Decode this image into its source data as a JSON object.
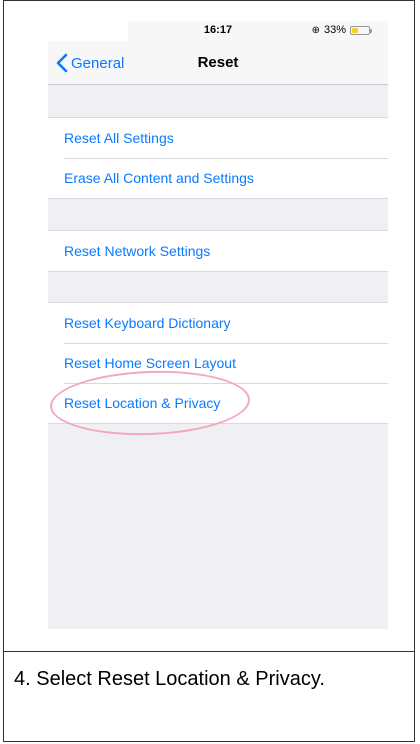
{
  "statusbar": {
    "time": "16:17",
    "battery_percent": "33%"
  },
  "navbar": {
    "back_label": "General",
    "title": "Reset"
  },
  "groups": [
    {
      "items": [
        {
          "label": "Reset All Settings"
        },
        {
          "label": "Erase All Content and Settings"
        }
      ]
    },
    {
      "items": [
        {
          "label": "Reset Network Settings"
        }
      ]
    },
    {
      "items": [
        {
          "label": "Reset Keyboard Dictionary"
        },
        {
          "label": "Reset Home Screen Layout"
        },
        {
          "label": "Reset Location & Privacy"
        }
      ]
    }
  ],
  "caption": "4. Select Reset Location & Privacy.",
  "colors": {
    "accent": "#0a7aff",
    "highlight": "#f3a6c2",
    "battery": "#f4d01e",
    "background": "#efeff4"
  }
}
